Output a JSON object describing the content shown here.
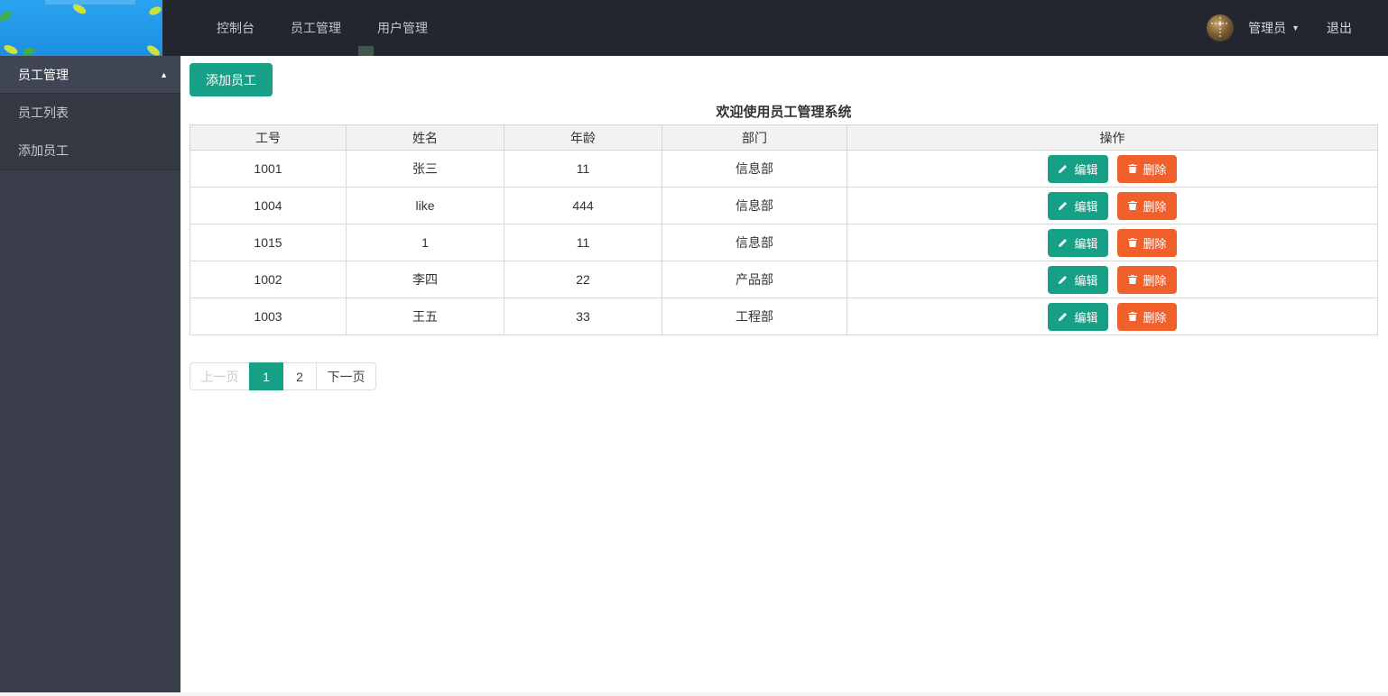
{
  "navbar": {
    "items": [
      {
        "label": "控制台"
      },
      {
        "label": "员工管理"
      },
      {
        "label": "用户管理"
      }
    ],
    "user": {
      "name": "管理员",
      "logout_label": "退出"
    }
  },
  "sidebar": {
    "menu": {
      "label": "员工管理",
      "expanded": true,
      "children": [
        {
          "label": "员工列表"
        },
        {
          "label": "添加员工"
        }
      ]
    }
  },
  "main": {
    "add_button_label": "添加员工",
    "welcome_title": "欢迎使用员工管理系统",
    "table": {
      "headers": [
        "工号",
        "姓名",
        "年龄",
        "部门",
        "操作"
      ],
      "rows": [
        {
          "id": "1001",
          "name": "张三",
          "age": "11",
          "dept": "信息部"
        },
        {
          "id": "1004",
          "name": "like",
          "age": "444",
          "dept": "信息部"
        },
        {
          "id": "1015",
          "name": "1",
          "age": "11",
          "dept": "信息部"
        },
        {
          "id": "1002",
          "name": "李四",
          "age": "22",
          "dept": "产品部"
        },
        {
          "id": "1003",
          "name": "王五",
          "age": "33",
          "dept": "工程部"
        }
      ],
      "actions": {
        "edit_label": "编辑",
        "delete_label": "删除"
      }
    },
    "pagination": {
      "prev_label": "上一页",
      "pages": [
        "1",
        "2"
      ],
      "active_page": "1",
      "next_label": "下一页"
    }
  },
  "icons": {
    "caret_down": "▼",
    "caret_up": "▲"
  },
  "colors": {
    "accent_teal": "#16a085",
    "danger_orange": "#f1602b",
    "navbar_bg": "#23262e",
    "sidebar_bg": "#393d49",
    "logo_blue": "#2196e8"
  }
}
